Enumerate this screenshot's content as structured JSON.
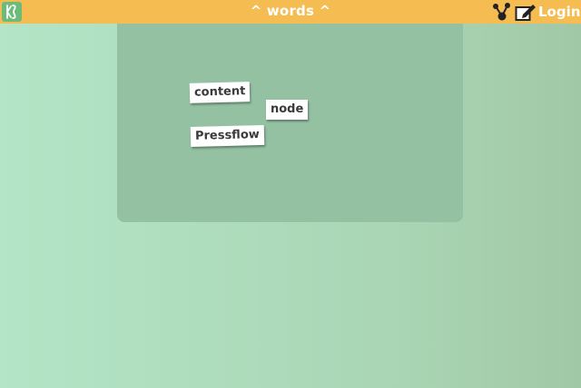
{
  "header": {
    "title": "^ words ^",
    "login_label": "Login",
    "bar_color": "#f5bc52",
    "logo_icon": "kanji-logo-icon",
    "share_icon": "share-network-icon",
    "edit_icon": "edit-note-icon"
  },
  "board": {
    "background_color": "#94c1a2",
    "words": [
      {
        "text": "content"
      },
      {
        "text": "node"
      },
      {
        "text": "Pressflow"
      }
    ]
  }
}
